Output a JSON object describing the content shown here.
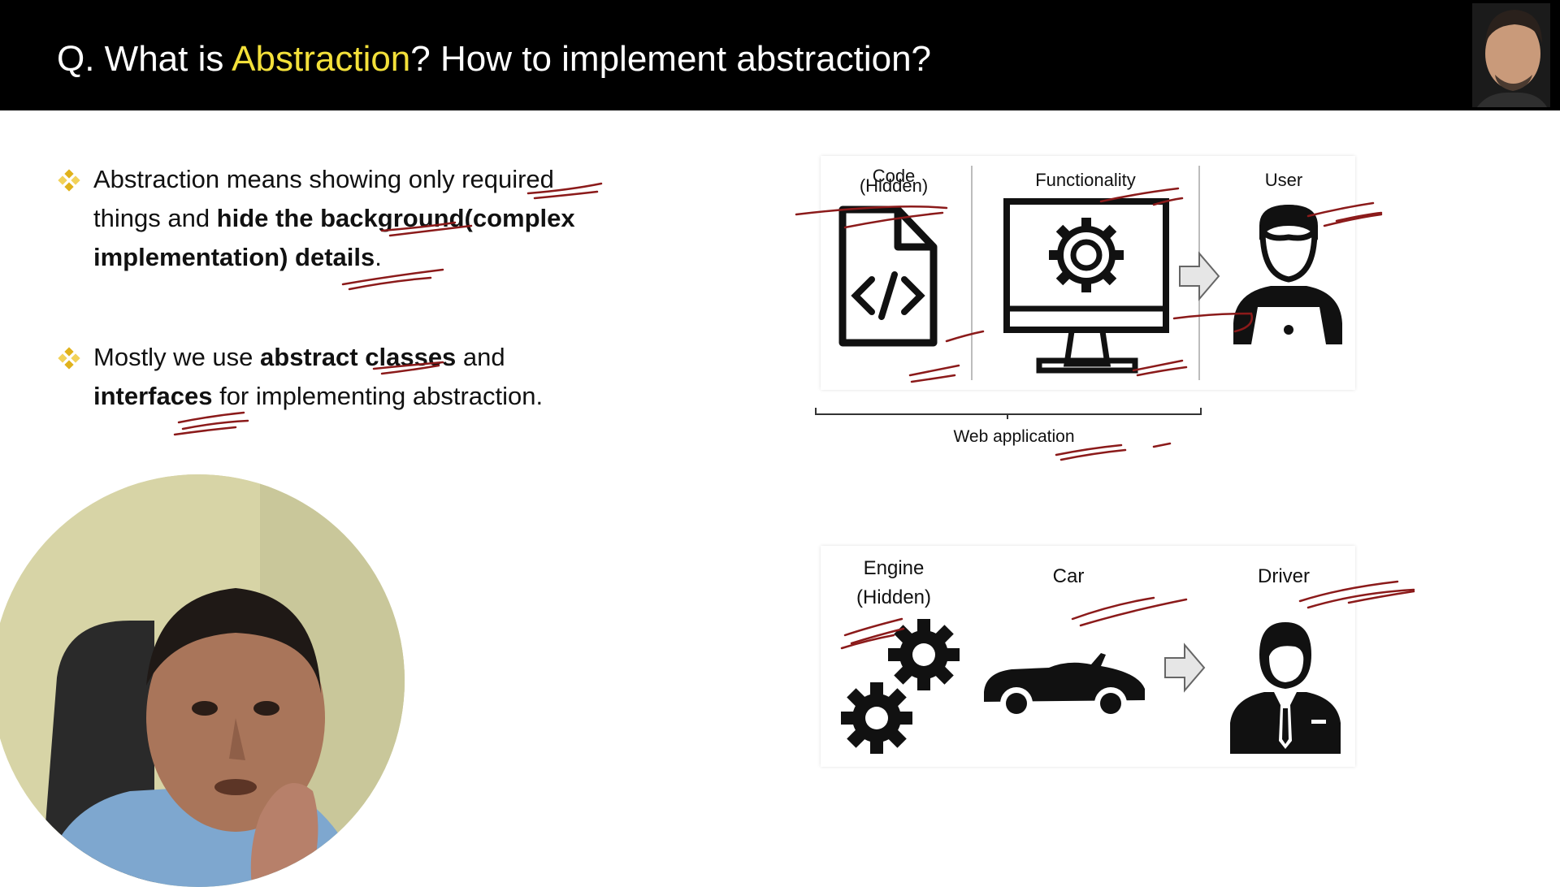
{
  "header": {
    "title_prefix": "Q. What is ",
    "title_highlight": "Abstraction",
    "title_suffix": "? How to implement abstraction?",
    "highlight_color": "#f3e03a"
  },
  "bullets": {
    "b1": {
      "part1": "Abstraction means showing only required things and ",
      "bold": "hide the background(complex implementation) details",
      "part2": "."
    },
    "b2": {
      "part1": "Mostly we use ",
      "bold1": "abstract classes",
      "part2": " and ",
      "bold2": "interfaces",
      "part3": " for implementing abstraction."
    },
    "bullet_icon": "diamond-bullet-icon"
  },
  "diagram_web": {
    "code_label": "Code",
    "code_sub": "(Hidden)",
    "functionality_label": "Functionality",
    "user_label": "User",
    "caption": "Web application",
    "icons": [
      "code-file-icon",
      "monitor-gear-icon",
      "arrow-right-icon",
      "user-laptop-icon"
    ]
  },
  "diagram_car": {
    "engine_label": "Engine",
    "engine_sub": "(Hidden)",
    "car_label": "Car",
    "driver_label": "Driver",
    "icons": [
      "gears-icon",
      "car-icon",
      "arrow-right-icon",
      "driver-icon"
    ]
  },
  "colors": {
    "header_bg": "#000000",
    "annotation_ink": "#8b1a1a",
    "bullet": "#e0b21c"
  }
}
